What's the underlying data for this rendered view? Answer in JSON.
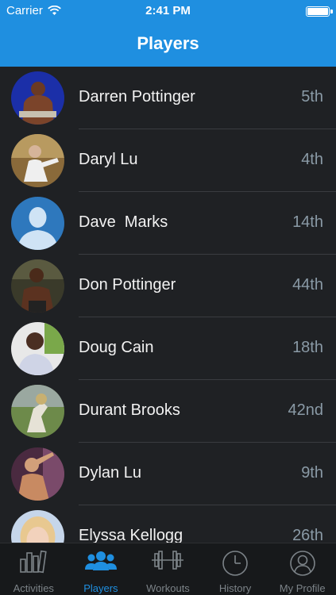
{
  "status_bar": {
    "carrier": "Carrier",
    "time": "2:41 PM"
  },
  "nav": {
    "title": "Players"
  },
  "players": [
    {
      "name": "Darren Pottinger",
      "rank": "5th"
    },
    {
      "name": "Daryl Lu",
      "rank": "4th"
    },
    {
      "name": "Dave  Marks",
      "rank": "14th"
    },
    {
      "name": "Don Pottinger",
      "rank": "44th"
    },
    {
      "name": "Doug Cain",
      "rank": "18th"
    },
    {
      "name": "Durant Brooks",
      "rank": "42nd"
    },
    {
      "name": "Dylan Lu",
      "rank": "9th"
    },
    {
      "name": "Elyssa Kellogg",
      "rank": "26th"
    }
  ],
  "tabs": [
    {
      "label": "Activities",
      "icon": "activities-icon"
    },
    {
      "label": "Players",
      "icon": "players-icon"
    },
    {
      "label": "Workouts",
      "icon": "dumbbell-icon"
    },
    {
      "label": "History",
      "icon": "clock-icon"
    },
    {
      "label": "My Profile",
      "icon": "profile-icon"
    }
  ],
  "colors": {
    "accent": "#1f8fe0",
    "background": "#1f2124",
    "rank_text": "#8a9aa6"
  }
}
